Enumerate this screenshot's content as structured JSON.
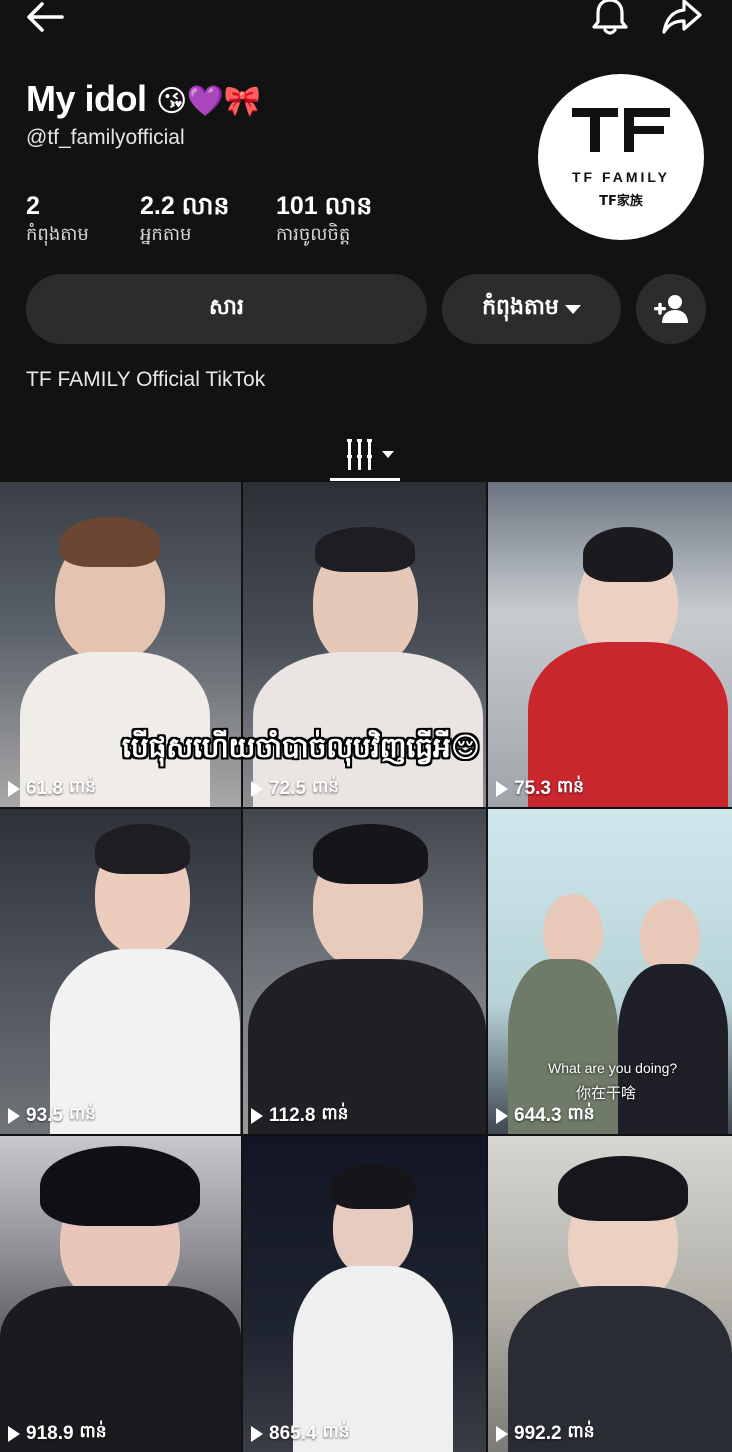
{
  "header": {
    "back_icon": "arrow-left-icon",
    "bell_icon": "bell-icon",
    "share_icon": "share-arrow-icon"
  },
  "profile": {
    "name": "My idol",
    "name_emojis": "😘💜🎀",
    "handle": "@tf_familyofficial",
    "avatar": {
      "logo_letters": "TF",
      "brand": "TF FAMILY",
      "brand_cn": "TF家族"
    },
    "stats": [
      {
        "value": "2",
        "label": "កំពុងតាម"
      },
      {
        "value": "2.2 លាន",
        "label": "អ្នកតាម"
      },
      {
        "value": "101 លាន",
        "label": "ការចូលចិត្ត"
      }
    ],
    "bio": "TF FAMILY Official TikTok"
  },
  "actions": {
    "message_label": "សារ",
    "following_label": "កំពុងតាម",
    "following_icon": "caret-down-icon",
    "add_friend_icon": "add-user-icon"
  },
  "tabs": {
    "videos_icon": "grid-columns-icon",
    "videos_caret": "caret-down-icon"
  },
  "videos": [
    {
      "views": "61.8",
      "unit": "ពាន់"
    },
    {
      "views": "72.5",
      "unit": "ពាន់"
    },
    {
      "views": "75.3",
      "unit": "ពាន់"
    },
    {
      "views": "93.5",
      "unit": "ពាន់"
    },
    {
      "views": "112.8",
      "unit": "ពាន់"
    },
    {
      "views": "644.3",
      "unit": "ពាន់"
    },
    {
      "views": "918.9",
      "unit": "ពាន់"
    },
    {
      "views": "865.4",
      "unit": "ពាន់"
    },
    {
      "views": "992.2",
      "unit": "ពាន់"
    }
  ],
  "overlay": {
    "caption": "បើផុសហើយចាំបាច់លុបវិញធ្វើអី😌",
    "subtitle_en": "What are you doing?",
    "subtitle_cn": "你在干啥"
  },
  "colors": {
    "background": "#121212",
    "button": "#2c2c2c",
    "text": "#ffffff"
  }
}
